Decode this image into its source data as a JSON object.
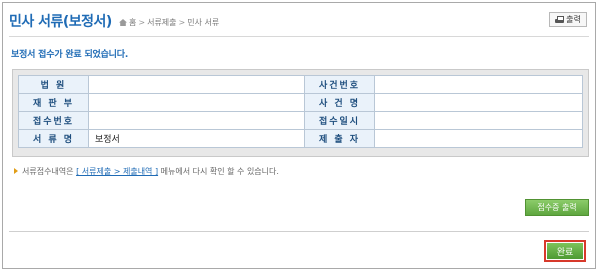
{
  "header": {
    "title": "민사 서류(보정서)",
    "breadcrumb": [
      "홈",
      "서류제출",
      "민사 서류"
    ],
    "print_label": "출력"
  },
  "notice": "보정서 접수가 완료 되었습니다.",
  "info_table": {
    "rows": [
      {
        "label1": "법 원",
        "value1": "",
        "label2": "사건번호",
        "value2": ""
      },
      {
        "label1": "재 판 부",
        "value1": "",
        "label2": "사 건 명",
        "value2": ""
      },
      {
        "label1": "접수번호",
        "value1": "",
        "label2": "접수일시",
        "value2": ""
      },
      {
        "label1": "서 류 명",
        "value1": "보정서",
        "label2": "제 출 자",
        "value2": ""
      }
    ]
  },
  "info_line": {
    "prefix": "서류접수내역은",
    "link": "[ 서류제출 > 제출내역 ]",
    "suffix": "메뉴에서 다시 확인 할 수 있습니다."
  },
  "buttons": {
    "receipt": "접수증 출력",
    "done": "완료"
  },
  "colors": {
    "title": "#1f6bb5",
    "button_green": "#5ea63f",
    "highlight_red": "#d7392b"
  }
}
